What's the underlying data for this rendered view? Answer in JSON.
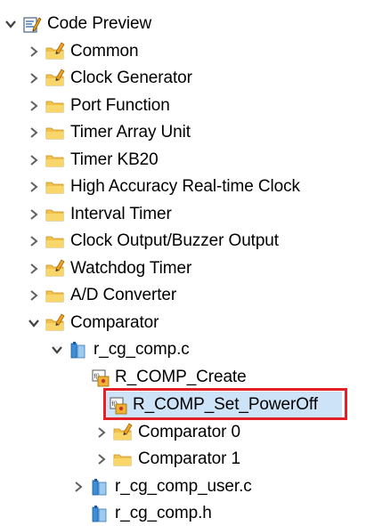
{
  "tree": {
    "root": {
      "label": "Code Preview",
      "icon": "code-preview-icon",
      "expanded": true
    },
    "items": [
      {
        "label": "Common",
        "icon": "folder-pencil-icon",
        "expanded": false
      },
      {
        "label": "Clock Generator",
        "icon": "folder-pencil-icon",
        "expanded": false
      },
      {
        "label": "Port Function",
        "icon": "folder-icon",
        "expanded": false
      },
      {
        "label": "Timer Array Unit",
        "icon": "folder-icon",
        "expanded": false
      },
      {
        "label": "Timer KB20",
        "icon": "folder-icon",
        "expanded": false
      },
      {
        "label": "High Accuracy Real-time Clock",
        "icon": "folder-icon",
        "expanded": false
      },
      {
        "label": "Interval Timer",
        "icon": "folder-icon",
        "expanded": false
      },
      {
        "label": "Clock Output/Buzzer Output",
        "icon": "folder-icon",
        "expanded": false
      },
      {
        "label": "Watchdog Timer",
        "icon": "folder-pencil-icon",
        "expanded": false
      },
      {
        "label": "A/D Converter",
        "icon": "folder-icon",
        "expanded": false
      },
      {
        "label": "Comparator",
        "icon": "folder-pencil-icon",
        "expanded": true
      }
    ],
    "comparator_children": {
      "file": {
        "label": "r_cg_comp.c",
        "icon": "c-file-icon",
        "expanded": true
      },
      "functions": [
        {
          "label": "R_COMP_Create",
          "icon": "function-icon"
        },
        {
          "label": "R_COMP_Set_PowerOff",
          "icon": "function-icon",
          "selected": true
        }
      ],
      "subfolders": [
        {
          "label": "Comparator 0",
          "icon": "folder-pencil-icon",
          "expanded": false
        },
        {
          "label": "Comparator 1",
          "icon": "folder-icon",
          "expanded": false
        }
      ],
      "user_file": {
        "label": "r_cg_comp_user.c",
        "icon": "c-file-icon",
        "expanded": false
      },
      "header_file": {
        "label": "r_cg_comp.h",
        "icon": "h-file-icon"
      }
    }
  }
}
